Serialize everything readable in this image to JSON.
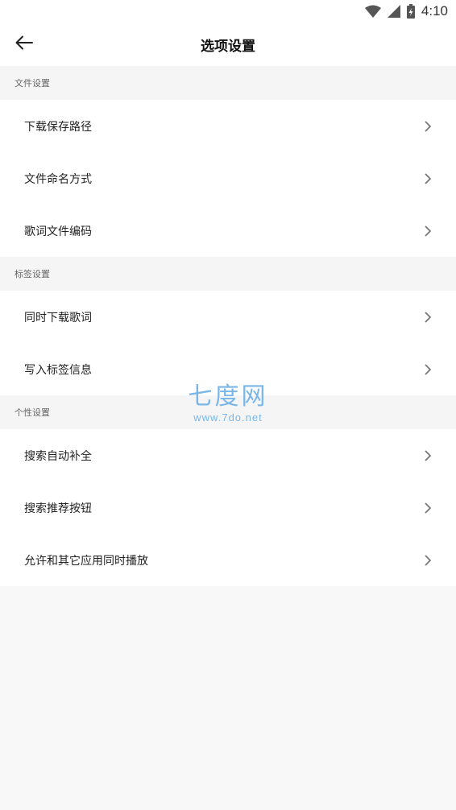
{
  "status_bar": {
    "time": "4:10",
    "icons": [
      "wifi-icon",
      "signal-icon",
      "battery-charging-icon"
    ]
  },
  "app_bar": {
    "back_icon": "arrow-left-icon",
    "title": "选项设置"
  },
  "sections": [
    {
      "header": "文件设置",
      "items": [
        {
          "label": "下载保存路径"
        },
        {
          "label": "文件命名方式"
        },
        {
          "label": "歌词文件编码"
        }
      ]
    },
    {
      "header": "标签设置",
      "items": [
        {
          "label": "同时下载歌词"
        },
        {
          "label": "写入标签信息"
        }
      ]
    },
    {
      "header": "个性设置",
      "items": [
        {
          "label": "搜索自动补全"
        },
        {
          "label": "搜索推荐按钮"
        },
        {
          "label": "允许和其它应用同时播放"
        }
      ]
    }
  ],
  "watermark": {
    "main": "七度网",
    "sub": "www.7do.net"
  },
  "colors": {
    "background": "#f8f8f8",
    "section_header_bg": "#f5f5f5",
    "item_bg": "#ffffff",
    "chevron": "#777777",
    "watermark": "#7ab7e8"
  }
}
